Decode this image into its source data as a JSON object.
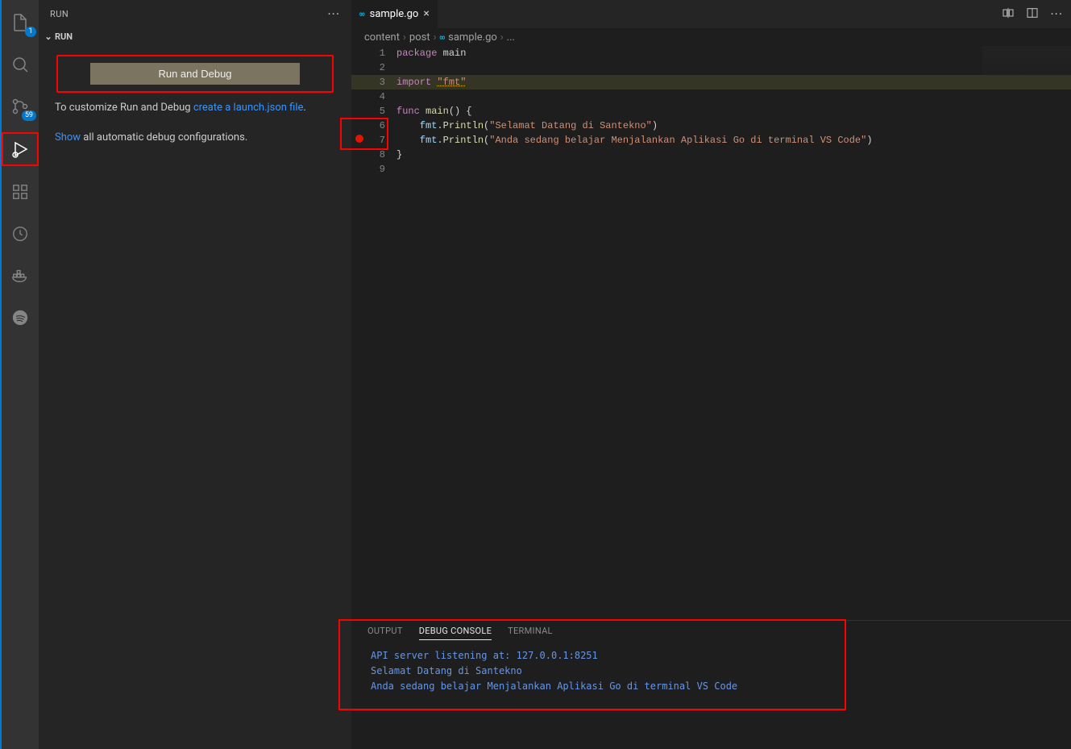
{
  "activity_bar": {
    "explorer_badge": "1",
    "scm_badge": "59"
  },
  "sidebar": {
    "title": "RUN",
    "section_label": "RUN",
    "run_debug_button": "Run and Debug",
    "customize_prefix": "To customize Run and Debug ",
    "customize_link": "create a launch.json file",
    "customize_suffix": ".",
    "show_link": "Show",
    "show_suffix": " all automatic debug configurations."
  },
  "tab": {
    "name": "sample.go"
  },
  "breadcrumbs": {
    "seg1": "content",
    "seg2": "post",
    "seg3": "sample.go",
    "seg4": "..."
  },
  "code": {
    "l1_kw": "package",
    "l1_ident": " main",
    "l3_kw": "import ",
    "l3_str": "\"fmt\"",
    "l5_kw": "func ",
    "l5_fn": "main",
    "l5_rest": "() {",
    "l6_pkg": "    fmt",
    "l6_dot": ".",
    "l6_fn": "Println",
    "l6_p": "(",
    "l6_str": "\"Selamat Datang di Santekno\"",
    "l6_pe": ")",
    "l7_pkg": "    fmt",
    "l7_dot": ".",
    "l7_fn": "Println",
    "l7_p": "(",
    "l7_str": "\"Anda sedang belajar Menjalankan Aplikasi Go di terminal VS Code\"",
    "l7_pe": ")",
    "l8": "}"
  },
  "line_numbers": [
    "1",
    "2",
    "3",
    "4",
    "5",
    "6",
    "7",
    "8",
    "9"
  ],
  "panel": {
    "tabs": {
      "output": "OUTPUT",
      "debug_console": "DEBUG CONSOLE",
      "terminal": "TERMINAL"
    },
    "l1": "API server listening at: 127.0.0.1:8251",
    "l2": "Selamat Datang di Santekno",
    "l3": "Anda sedang belajar Menjalankan Aplikasi Go di terminal VS Code"
  }
}
